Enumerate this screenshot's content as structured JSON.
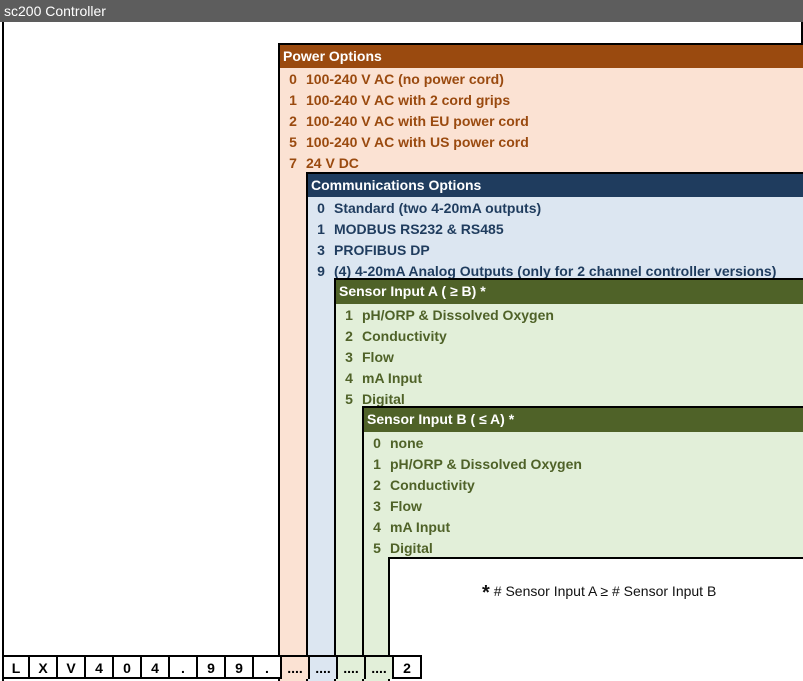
{
  "title": "sc200 Controller",
  "power_options": {
    "header": "Power Options",
    "items": [
      {
        "code": "0",
        "label": "100-240 V AC (no power cord)"
      },
      {
        "code": "1",
        "label": "100-240 V AC with 2 cord grips"
      },
      {
        "code": "2",
        "label": "100-240 V AC with EU power cord"
      },
      {
        "code": "5",
        "label": "100-240 V AC with US power cord"
      },
      {
        "code": "7",
        "label": "24 V DC"
      }
    ]
  },
  "communications_options": {
    "header": "Communications Options",
    "items": [
      {
        "code": "0",
        "label": "Standard (two 4-20mA outputs)"
      },
      {
        "code": "1",
        "label": "MODBUS RS232 & RS485"
      },
      {
        "code": "3",
        "label": "PROFIBUS DP"
      },
      {
        "code": "9",
        "label": "(4) 4-20mA Analog Outputs (only for 2 channel controller versions)"
      }
    ]
  },
  "sensor_input_a": {
    "header": "Sensor Input A ( ≥ B) *",
    "items": [
      {
        "code": "1",
        "label": "pH/ORP & Dissolved Oxygen"
      },
      {
        "code": "2",
        "label": "Conductivity"
      },
      {
        "code": "3",
        "label": "Flow"
      },
      {
        "code": "4",
        "label": "mA Input"
      },
      {
        "code": "5",
        "label": "Digital"
      }
    ]
  },
  "sensor_input_b": {
    "header": "Sensor Input B ( ≤ A) *",
    "items": [
      {
        "code": "0",
        "label": "none"
      },
      {
        "code": "1",
        "label": "pH/ORP & Dissolved Oxygen"
      },
      {
        "code": "2",
        "label": "Conductivity"
      },
      {
        "code": "3",
        "label": "Flow"
      },
      {
        "code": "4",
        "label": "mA Input"
      },
      {
        "code": "5",
        "label": "Digital"
      }
    ]
  },
  "footnote": {
    "star": "*",
    "text": "# Sensor Input A ≥ # Sensor Input B"
  },
  "part_code": [
    "L",
    "X",
    "V",
    "4",
    "0",
    "4",
    ".",
    "9",
    "9",
    ".",
    "....",
    "....",
    "....",
    "....",
    "2"
  ],
  "colors": {
    "power_header": "#9a4a0f",
    "power_bg": "#fbe2d3",
    "comm_header": "#1f3c5e",
    "comm_bg": "#dce6f1",
    "sensor_header": "#4f6228",
    "sensor_bg": "#e2efd9"
  }
}
